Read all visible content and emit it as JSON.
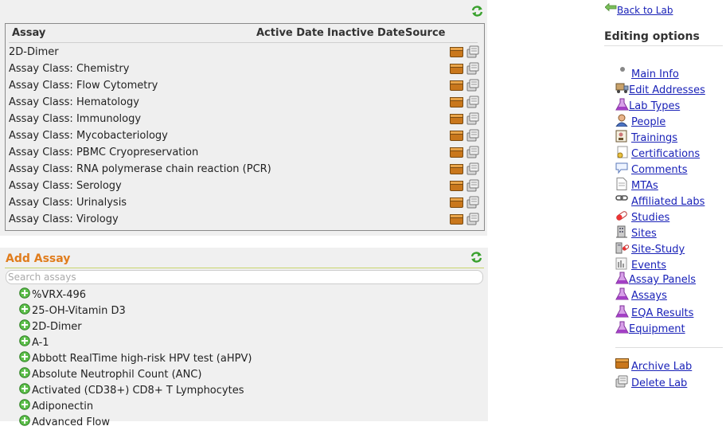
{
  "assay_list": {
    "headers": [
      "Assay",
      "Active Date",
      "Inactive Date",
      "Source"
    ],
    "rows": [
      {
        "name": "2D-Dimer"
      },
      {
        "name": "Assay Class: Chemistry"
      },
      {
        "name": "Assay Class: Flow Cytometry"
      },
      {
        "name": "Assay Class: Hematology"
      },
      {
        "name": "Assay Class: Immunology"
      },
      {
        "name": "Assay Class: Mycobacteriology"
      },
      {
        "name": "Assay Class: PBMC Cryopreservation"
      },
      {
        "name": "Assay Class: RNA polymerase chain reaction (PCR)"
      },
      {
        "name": "Assay Class: Serology"
      },
      {
        "name": "Assay Class: Urinalysis"
      },
      {
        "name": "Assay Class: Virology"
      }
    ]
  },
  "add_assay": {
    "title": "Add Assay",
    "search_placeholder": "Search assays",
    "items": [
      "%VRX-496",
      "25-OH-Vitamin D3",
      "2D-Dimer",
      "A-1",
      "Abbott RealTime high-risk HPV test (aHPV)",
      "Absolute Neutrophil Count (ANC)",
      "Activated (CD38+) CD8+ T Lymphocytes",
      "Adiponectin",
      "Advanced Flow"
    ]
  },
  "sidebar": {
    "back_label": "Back to Lab",
    "editing_title": "Editing options",
    "options": [
      {
        "label": "Main Info",
        "icon": "bullet-icon",
        "space": true
      },
      {
        "label": "Edit Addresses",
        "icon": "truck-icon",
        "space": false
      },
      {
        "label": "Lab Types",
        "icon": "flask-icon",
        "space": false
      },
      {
        "label": "People",
        "icon": "person-icon",
        "space": true
      },
      {
        "label": "Trainings",
        "icon": "training-icon",
        "space": true
      },
      {
        "label": "Certifications",
        "icon": "certificate-icon",
        "space": true
      },
      {
        "label": "Comments",
        "icon": "comment-icon",
        "space": true
      },
      {
        "label": "MTAs",
        "icon": "document-icon",
        "space": true
      },
      {
        "label": "Affiliated Labs",
        "icon": "link-icon",
        "space": true
      },
      {
        "label": "Studies",
        "icon": "pill-icon",
        "space": true
      },
      {
        "label": "Sites",
        "icon": "building-icon",
        "space": true
      },
      {
        "label": "Site-Study",
        "icon": "site-study-icon",
        "space": true
      },
      {
        "label": "Events",
        "icon": "events-icon",
        "space": true
      },
      {
        "label": "Assay Panels",
        "icon": "flask-icon",
        "space": false
      },
      {
        "label": "Assays",
        "icon": "flask-icon",
        "space": true
      },
      {
        "label": "EQA Results",
        "icon": "flask-icon",
        "space": true
      },
      {
        "label": "Equipment",
        "icon": "flask-icon",
        "space": false
      }
    ],
    "actions": [
      {
        "label": "Archive Lab",
        "icon": "archive-icon"
      },
      {
        "label": "Delete Lab",
        "icon": "delete-icon"
      }
    ]
  }
}
